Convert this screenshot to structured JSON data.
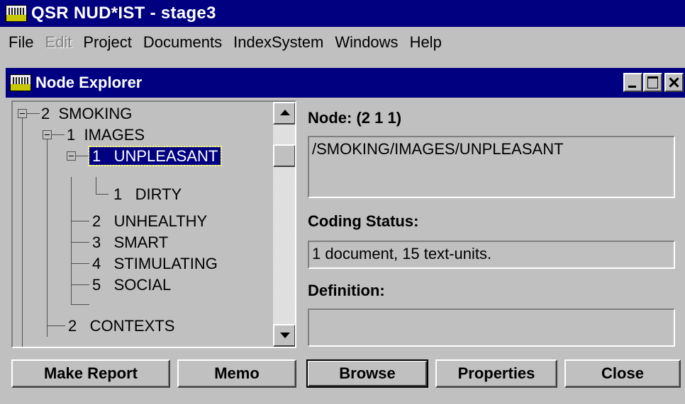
{
  "app": {
    "title": "QSR NUD*IST - stage3"
  },
  "menu": [
    "File",
    "Edit",
    "Project",
    "Documents",
    "IndexSystem",
    "Windows",
    "Help"
  ],
  "node_explorer": {
    "title": "Node Explorer",
    "tree": [
      {
        "num": "2",
        "label": "SMOKING",
        "depth": 0,
        "expanded": true
      },
      {
        "num": "1",
        "label": "IMAGES",
        "depth": 1,
        "expanded": true
      },
      {
        "num": "1",
        "label": "UNPLEASANT",
        "depth": 2,
        "expanded": true,
        "selected": true
      },
      {
        "num": "1",
        "label": "DIRTY",
        "depth": 3
      },
      {
        "num": "2",
        "label": "UNHEALTHY",
        "depth": 2
      },
      {
        "num": "3",
        "label": "SMART",
        "depth": 2
      },
      {
        "num": "4",
        "label": "STIMULATING",
        "depth": 2
      },
      {
        "num": "5",
        "label": "SOCIAL",
        "depth": 2
      },
      {
        "num": "2",
        "label": "CONTEXTS",
        "depth": 1
      }
    ],
    "node_header": "Node: (2 1 1)",
    "node_path": "/SMOKING/IMAGES/UNPLEASANT",
    "coding_status_label": "Coding Status:",
    "coding_status_value": "1 document, 15 text-units.",
    "definition_label": "Definition:",
    "definition_value": "",
    "buttons": {
      "make_report": "Make Report",
      "memo": "Memo",
      "browse": "Browse",
      "properties": "Properties",
      "close": "Close"
    }
  }
}
